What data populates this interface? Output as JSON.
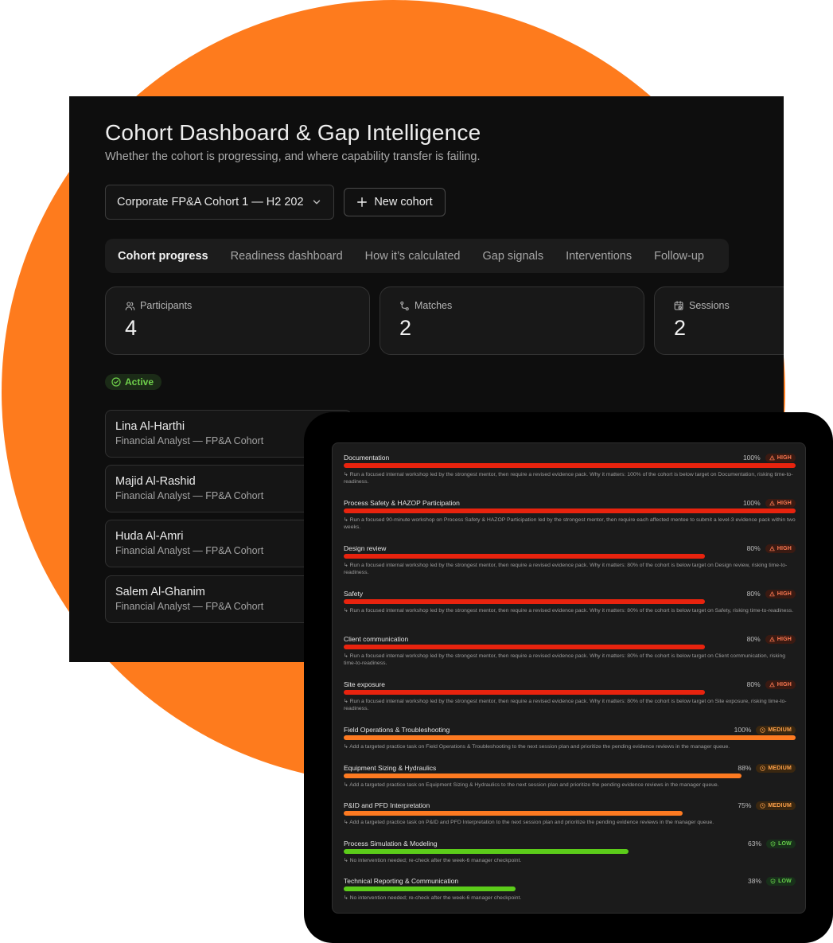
{
  "header": {
    "title": "Cohort Dashboard & Gap Intelligence",
    "subtitle": "Whether the cohort is progressing, and where capability transfer is failing."
  },
  "cohort_select": {
    "value": "Corporate FP&A Cohort 1 — H2 202"
  },
  "new_cohort_label": "New cohort",
  "tabs": [
    {
      "label": "Cohort progress",
      "active": true
    },
    {
      "label": "Readiness dashboard"
    },
    {
      "label": "How it’s calculated"
    },
    {
      "label": "Gap signals"
    },
    {
      "label": "Interventions"
    },
    {
      "label": "Follow-up"
    }
  ],
  "stats": [
    {
      "label": "Participants",
      "value": "4",
      "icon": "users-icon"
    },
    {
      "label": "Matches",
      "value": "2",
      "icon": "route-icon"
    },
    {
      "label": "Sessions",
      "value": "2",
      "icon": "calendar-clock-icon"
    }
  ],
  "status_badge": "Active",
  "participants": [
    {
      "name": "Lina Al-Harthi",
      "role": "Financial Analyst — FP&A Cohort"
    },
    {
      "name": "Majid Al-Rashid",
      "role": "Financial Analyst — FP&A Cohort"
    },
    {
      "name": "Huda Al-Amri",
      "role": "Financial Analyst — FP&A Cohort"
    },
    {
      "name": "Salem Al-Ghanim",
      "role": "Financial Analyst — FP&A Cohort"
    }
  ],
  "colors": {
    "high": "#e8230e",
    "medium": "#fd7a21",
    "low": "#5ccc1a",
    "accent": "#fe7b1d"
  },
  "gaps": [
    {
      "name": "Documentation",
      "pct": "100%",
      "severity": "HIGH",
      "fill": 1.0,
      "note": "↳ Run a focused internal workshop led by the strongest mentor, then require a revised evidence pack. Why it matters: 100% of the cohort is below target on Documentation, risking time-to-readiness."
    },
    {
      "name": "Process Safety & HAZOP Participation",
      "pct": "100%",
      "severity": "HIGH",
      "fill": 1.0,
      "note": "↳ Run a focused 90-minute workshop on Process Safety & HAZOP Participation led by the strongest mentor, then require each affected mentee to submit a level-3 evidence pack within two weeks."
    },
    {
      "name": "Design review",
      "pct": "80%",
      "severity": "HIGH",
      "fill": 0.8,
      "note": "↳ Run a focused internal workshop led by the strongest mentor, then require a revised evidence pack. Why it matters: 80% of the cohort is below target on Design review, risking time-to-readiness."
    },
    {
      "name": "Safety",
      "pct": "80%",
      "severity": "HIGH",
      "fill": 0.8,
      "note": "↳ Run a focused internal workshop led by the strongest mentor, then require a revised evidence pack. Why it matters: 80% of the cohort is below target on Safety, risking time-to-readiness."
    },
    {
      "name": "Client communication",
      "pct": "80%",
      "severity": "HIGH",
      "fill": 0.8,
      "note": "↳ Run a focused internal workshop led by the strongest mentor, then require a revised evidence pack. Why it matters: 80% of the cohort is below target on Client communication, risking time-to-readiness."
    },
    {
      "name": "Site exposure",
      "pct": "80%",
      "severity": "HIGH",
      "fill": 0.8,
      "note": "↳ Run a focused internal workshop led by the strongest mentor, then require a revised evidence pack. Why it matters: 80% of the cohort is below target on Site exposure, risking time-to-readiness."
    },
    {
      "name": "Field Operations & Troubleshooting",
      "pct": "100%",
      "severity": "MEDIUM",
      "fill": 1.0,
      "note": "↳ Add a targeted practice task on Field Operations & Troubleshooting to the next session plan and prioritize the pending evidence reviews in the manager queue."
    },
    {
      "name": "Equipment Sizing & Hydraulics",
      "pct": "88%",
      "severity": "MEDIUM",
      "fill": 0.88,
      "note": "↳ Add a targeted practice task on Equipment Sizing & Hydraulics to the next session plan and prioritize the pending evidence reviews in the manager queue."
    },
    {
      "name": "P&ID and PFD Interpretation",
      "pct": "75%",
      "severity": "MEDIUM",
      "fill": 0.75,
      "note": "↳ Add a targeted practice task on P&ID and PFD Interpretation to the next session plan and prioritize the pending evidence reviews in the manager queue."
    },
    {
      "name": "Process Simulation & Modeling",
      "pct": "63%",
      "severity": "LOW",
      "fill": 0.63,
      "note": "↳ No intervention needed; re-check after the week-6 manager checkpoint."
    },
    {
      "name": "Technical Reporting & Communication",
      "pct": "38%",
      "severity": "LOW",
      "fill": 0.38,
      "note": "↳ No intervention needed; re-check after the week-6 manager checkpoint."
    }
  ]
}
